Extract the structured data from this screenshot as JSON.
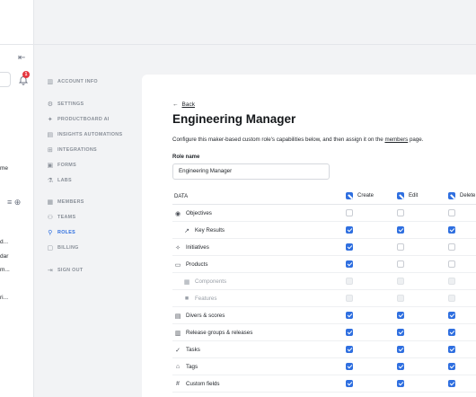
{
  "sidebar": {
    "badge_count": "1",
    "cut_items": [
      "me",
      "d...",
      "dar",
      "m...",
      "ri..."
    ]
  },
  "nav": {
    "items": [
      {
        "label": "ACCOUNT INFO",
        "icon": "building-icon"
      },
      {
        "label": "SETTINGS",
        "icon": "gear-icon"
      },
      {
        "label": "PRODUCTBOARD AI",
        "icon": "sparkle-icon"
      },
      {
        "label": "INSIGHTS AUTOMATIONS",
        "icon": "automation-icon"
      },
      {
        "label": "INTEGRATIONS",
        "icon": "plug-icon"
      },
      {
        "label": "FORMS",
        "icon": "form-icon"
      },
      {
        "label": "LABS",
        "icon": "flask-icon"
      },
      {
        "label": "MEMBERS",
        "icon": "members-icon"
      },
      {
        "label": "TEAMS",
        "icon": "teams-icon"
      },
      {
        "label": "ROLES",
        "icon": "roles-icon",
        "active": true
      },
      {
        "label": "BILLING",
        "icon": "billing-icon"
      },
      {
        "label": "SIGN OUT",
        "icon": "sign-out-icon"
      }
    ]
  },
  "page": {
    "back_label": "Back",
    "title": "Engineering Manager",
    "description_prefix": "Configure this maker-based custom role's capabilities below, and then assign it on the ",
    "description_link": "members",
    "description_suffix": " page.",
    "role_name_label": "Role name",
    "role_name_value": "Engineering Manager"
  },
  "table": {
    "data_header": "DATA",
    "columns": [
      "Create",
      "Edit",
      "Delete"
    ],
    "rows": [
      {
        "label": "Objectives",
        "icon": "objectives-icon",
        "indent": false,
        "state": [
          "off",
          "off",
          "off"
        ]
      },
      {
        "label": "Key Results",
        "icon": "key-results-icon",
        "indent": true,
        "state": [
          "on",
          "on",
          "on"
        ]
      },
      {
        "label": "Initiatives",
        "icon": "initiatives-icon",
        "indent": false,
        "state": [
          "on",
          "off",
          "off"
        ]
      },
      {
        "label": "Products",
        "icon": "products-icon",
        "indent": false,
        "state": [
          "on",
          "off",
          "off"
        ]
      },
      {
        "label": "Components",
        "icon": "components-icon",
        "indent": true,
        "muted": true,
        "state": [
          "dis",
          "dis",
          "dis"
        ]
      },
      {
        "label": "Features",
        "icon": "features-icon",
        "indent": true,
        "muted": true,
        "state": [
          "dis",
          "dis",
          "dis"
        ]
      },
      {
        "label": "Divers & scores",
        "icon": "drivers-icon",
        "indent": false,
        "state": [
          "on",
          "on",
          "on"
        ]
      },
      {
        "label": "Release groups & releases",
        "icon": "releases-icon",
        "indent": false,
        "state": [
          "on",
          "on",
          "on"
        ]
      },
      {
        "label": "Tasks",
        "icon": "tasks-icon",
        "indent": false,
        "state": [
          "on",
          "on",
          "on"
        ]
      },
      {
        "label": "Tags",
        "icon": "tag-icon",
        "indent": false,
        "state": [
          "on",
          "on",
          "on"
        ]
      },
      {
        "label": "Custom fields",
        "icon": "hash-icon",
        "indent": false,
        "state": [
          "on",
          "on",
          "on"
        ]
      }
    ]
  },
  "colors": {
    "accent": "#2f6fe0",
    "badge": "#e5373f"
  }
}
